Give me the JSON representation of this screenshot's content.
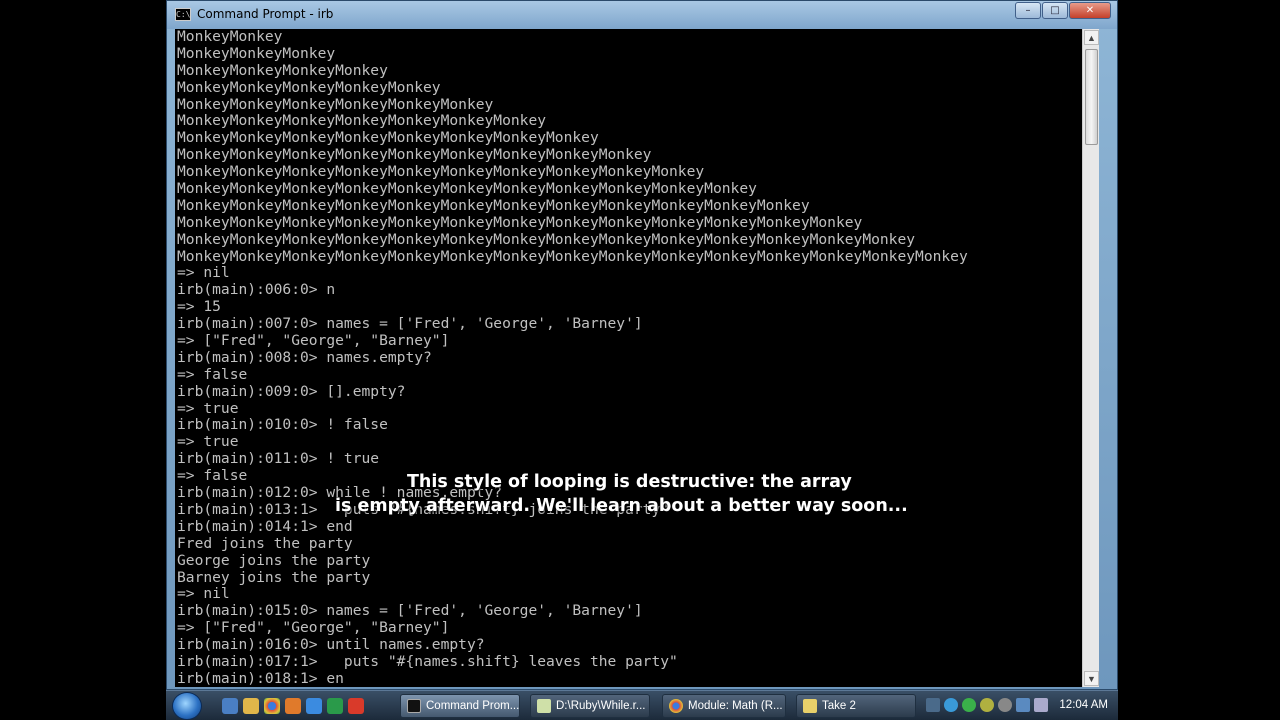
{
  "window": {
    "title": "Command Prompt - irb",
    "icon_text": "C:\\",
    "minimize": "–",
    "maximize": "□",
    "close": "✕"
  },
  "console": {
    "lines": [
      "MonkeyMonkey",
      "MonkeyMonkeyMonkey",
      "MonkeyMonkeyMonkeyMonkey",
      "MonkeyMonkeyMonkeyMonkeyMonkey",
      "MonkeyMonkeyMonkeyMonkeyMonkeyMonkey",
      "MonkeyMonkeyMonkeyMonkeyMonkeyMonkeyMonkey",
      "MonkeyMonkeyMonkeyMonkeyMonkeyMonkeyMonkeyMonkey",
      "MonkeyMonkeyMonkeyMonkeyMonkeyMonkeyMonkeyMonkeyMonkey",
      "MonkeyMonkeyMonkeyMonkeyMonkeyMonkeyMonkeyMonkeyMonkeyMonkey",
      "MonkeyMonkeyMonkeyMonkeyMonkeyMonkeyMonkeyMonkeyMonkeyMonkeyMonkey",
      "MonkeyMonkeyMonkeyMonkeyMonkeyMonkeyMonkeyMonkeyMonkeyMonkeyMonkeyMonkey",
      "MonkeyMonkeyMonkeyMonkeyMonkeyMonkeyMonkeyMonkeyMonkeyMonkeyMonkeyMonkeyMonkey",
      "MonkeyMonkeyMonkeyMonkeyMonkeyMonkeyMonkeyMonkeyMonkeyMonkeyMonkeyMonkeyMonkeyMonkey",
      "MonkeyMonkeyMonkeyMonkeyMonkeyMonkeyMonkeyMonkeyMonkeyMonkeyMonkeyMonkeyMonkeyMonkeyMonkey",
      "=> nil",
      "irb(main):006:0> n",
      "=> 15",
      "irb(main):007:0> names = ['Fred', 'George', 'Barney']",
      "=> [\"Fred\", \"George\", \"Barney\"]",
      "irb(main):008:0> names.empty?",
      "=> false",
      "irb(main):009:0> [].empty?",
      "=> true",
      "irb(main):010:0> ! false",
      "=> true",
      "irb(main):011:0> ! true",
      "=> false",
      "irb(main):012:0> while ! names.empty?",
      "irb(main):013:1>   puts \"#{names.shift} joins the party\"",
      "irb(main):014:1> end",
      "Fred joins the party",
      "George joins the party",
      "Barney joins the party",
      "=> nil",
      "irb(main):015:0> names = ['Fred', 'George', 'Barney']",
      "=> [\"Fred\", \"George\", \"Barney\"]",
      "irb(main):016:0> until names.empty?",
      "irb(main):017:1>   puts \"#{names.shift} leaves the party\"",
      "irb(main):018:1> en"
    ]
  },
  "caption": {
    "line1": "This style of looping is destructive: the array",
    "line2": "is empty afterward.  We'll learn about a better way soon..."
  },
  "taskbar": {
    "tasks": [
      {
        "label": "Command Prom..."
      },
      {
        "label": "D:\\Ruby\\While.r..."
      },
      {
        "label": "Module: Math (R..."
      },
      {
        "label": "Take 2"
      }
    ],
    "clock": "12:04 AM"
  },
  "colors": {
    "console_bg": "#000000",
    "console_text": "#c0c0c0",
    "caption_text": "#ffffff"
  }
}
